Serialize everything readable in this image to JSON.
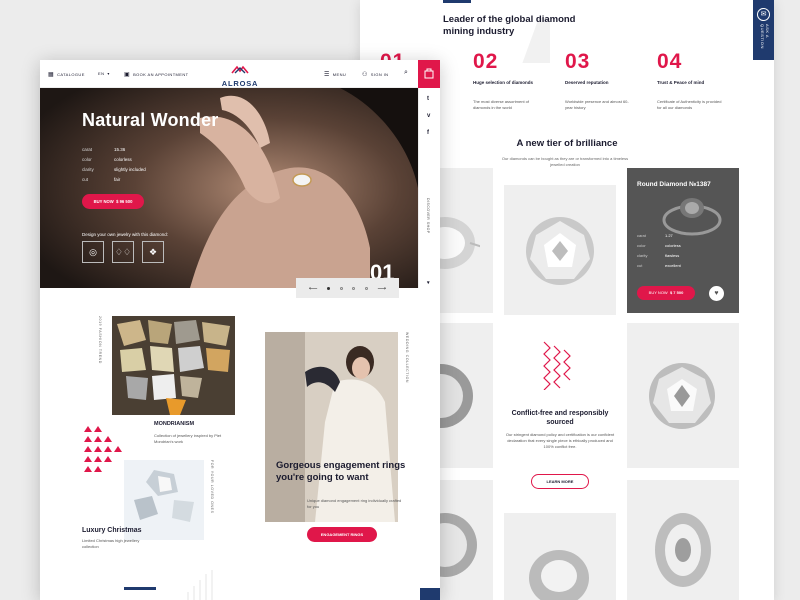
{
  "colors": {
    "accent": "#e0174a",
    "navy": "#1f3a6e",
    "dark_card": "#555555"
  },
  "back": {
    "leader_title": "Leader of the global diamond mining industry",
    "side_tab_label": "ASK A QUESTION",
    "stats": [
      {
        "num": "01",
        "label": "",
        "desc": ""
      },
      {
        "num": "02",
        "label": "Huge selection of diamonds",
        "desc": "The most diverse assortment of diamonds in the world"
      },
      {
        "num": "03",
        "label": "Deserved reputation",
        "desc": "Worldwide presence and almost 60-year history"
      },
      {
        "num": "04",
        "label": "Trust & Peace of mind",
        "desc": "Certificate of Authenticity is provided for all our diamonds"
      }
    ],
    "tier_title": "A new tier of brilliance",
    "tier_sub": "Our diamonds can be bought as they are or transformed into a timeless jewelled creation",
    "diamond_card": {
      "title": "Round Diamond №1387",
      "specs": [
        {
          "k": "carat",
          "v": "1.27"
        },
        {
          "k": "color",
          "v": "colorless"
        },
        {
          "k": "clarity",
          "v": "flawless"
        },
        {
          "k": "cut",
          "v": "excellent"
        }
      ],
      "buy_label": "BUY NOW",
      "price": "$ 7 500"
    },
    "conflict_title": "Conflict-free and responsibly sourced",
    "conflict_desc": "Our stringent diamond policy and certification is our confident declaration that every single piece is ethically produced and 100% conflict free.",
    "learn_more": "LEARN MORE"
  },
  "front": {
    "topbar": {
      "catalogue": "CATALOGUE",
      "lang": "EN",
      "appointment": "BOOK AN APPOINTMENT",
      "logo": "ALROSA",
      "menu": "MENU",
      "signin": "SIGN IN"
    },
    "hero": {
      "title": "Natural Wonder",
      "specs": [
        {
          "k": "carat",
          "v": "15.36"
        },
        {
          "k": "color",
          "v": "colorless"
        },
        {
          "k": "clarity",
          "v": "slightly included"
        },
        {
          "k": "cut",
          "v": "fair"
        }
      ],
      "buy_label": "BUY NOW",
      "price": "$ 96 500",
      "design_label": "Design your own jewelry with this diamond:",
      "slide_number": "01",
      "side_label": "DISCOVER SHOP"
    },
    "mondrianism": {
      "vert_label": "2019 FASHION TREND",
      "title": "MONDRIANISM",
      "desc": "Collection of jewellery inspired by Piet Mondrian's work"
    },
    "xmas": {
      "vert_label": "FOR YOUR LOVED ONES",
      "title": "Luxury Christmas",
      "desc": "Limited Christmas high jewellery collection"
    },
    "wedding": {
      "vert_label": "WEDDING COLLECTION",
      "title": "Gorgeous engagement rings you're going to want",
      "desc": "Unique diamond engagement ring individually crafted for you",
      "button": "ENGAGEMENT RINGS"
    }
  }
}
